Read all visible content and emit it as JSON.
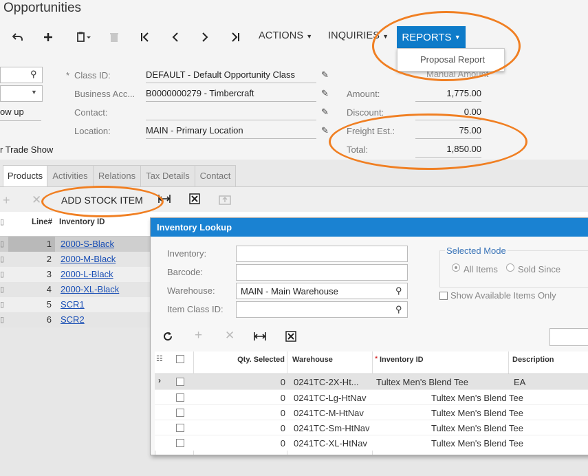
{
  "page": {
    "title": "Opportunities"
  },
  "toolbar": {
    "undo_icon": "undo-icon",
    "add_icon": "plus-icon",
    "copy_icon": "clipboard-icon",
    "delete_icon": "trash-icon",
    "first_icon": "first-record-icon",
    "prev_icon": "prev-icon",
    "next_icon": "next-icon",
    "last_icon": "last-record-icon",
    "actions": "ACTIONS",
    "inquiries": "INQUIRIES",
    "reports": "REPORTS"
  },
  "reports_menu": {
    "items": [
      "Proposal Report"
    ]
  },
  "form": {
    "left_partial": {
      "stage": "ow up",
      "source": "r Trade Show"
    },
    "class_id_label": "Class ID:",
    "class_id_value": "DEFAULT - Default Opportunity Class",
    "business_label": "Business Acc...",
    "business_value": "B0000000279 - Timbercraft",
    "contact_label": "Contact:",
    "contact_value": "",
    "location_label": "Location:",
    "location_value": "MAIN - Primary Location",
    "manual_amount": "Manual Amount",
    "amount_label": "Amount:",
    "amount_value": "1,775.00",
    "discount_label": "Discount:",
    "discount_value": "0.00",
    "freight_label": "Freight Est.:",
    "freight_value": "75.00",
    "total_label": "Total:",
    "total_value": "1,850.00"
  },
  "tabs": [
    "Products",
    "Activities",
    "Relations",
    "Tax Details",
    "Contact"
  ],
  "products": {
    "add_stock_item": "ADD STOCK ITEM",
    "headers": {
      "line": "Line#",
      "inventory": "Inventory ID"
    },
    "rows": [
      {
        "line": "1",
        "inventory": "2000-S-Black"
      },
      {
        "line": "2",
        "inventory": "2000-M-Black"
      },
      {
        "line": "3",
        "inventory": "2000-L-Black"
      },
      {
        "line": "4",
        "inventory": "2000-XL-Black"
      },
      {
        "line": "5",
        "inventory": "SCR1"
      },
      {
        "line": "6",
        "inventory": "SCR2"
      }
    ]
  },
  "lookup": {
    "title": "Inventory Lookup",
    "inventory_label": "Inventory:",
    "inventory_value": "",
    "barcode_label": "Barcode:",
    "barcode_value": "",
    "warehouse_label": "Warehouse:",
    "warehouse_value": "MAIN - Main Warehouse",
    "item_class_label": "Item Class ID:",
    "item_class_value": "",
    "selected_mode": "Selected Mode",
    "all_items": "All Items",
    "sold_since": "Sold Since",
    "show_available": "Show Available Items Only",
    "headers": {
      "qty": "Qty. Selected",
      "warehouse": "Warehouse",
      "inventory": "Inventory ID",
      "description": "Description"
    },
    "rows": [
      {
        "qty": "0",
        "warehouse": "0241TC-2X-Ht...",
        "inventory": "Tultex Men's Blend Tee",
        "description": "EA"
      },
      {
        "qty": "0",
        "warehouse": "0241TC-Lg-HtNav",
        "inventory": "Tultex Men's Blend Tee",
        "description": ""
      },
      {
        "qty": "0",
        "warehouse": "0241TC-M-HtNav",
        "inventory": "Tultex Men's Blend Tee",
        "description": ""
      },
      {
        "qty": "0",
        "warehouse": "0241TC-Sm-HtNav",
        "inventory": "Tultex Men's Blend Tee",
        "description": ""
      },
      {
        "qty": "0",
        "warehouse": "0241TC-XL-HtNav",
        "inventory": "Tultex Men's Blend Tee",
        "description": ""
      }
    ]
  },
  "colors": {
    "accent": "#0e7bc9",
    "highlight_oval": "#f07f22",
    "link": "#1a4fb5"
  }
}
